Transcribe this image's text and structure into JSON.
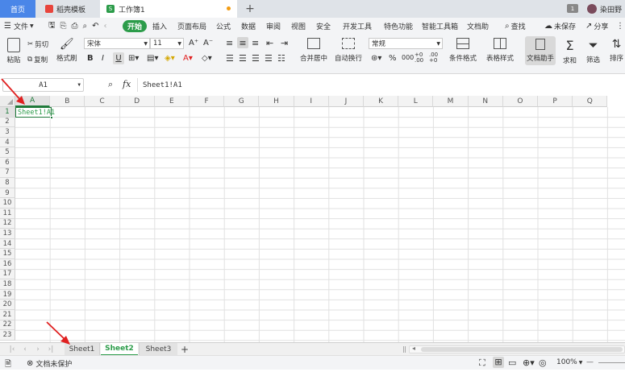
{
  "tabs": {
    "home": "首页",
    "template": "稻壳模板",
    "workbook": "工作簿1"
  },
  "top_right": {
    "badge": "1",
    "user": "染田野"
  },
  "menu": {
    "file": "文件",
    "start": "开始",
    "items": [
      "插入",
      "页面布局",
      "公式",
      "数据",
      "审阅",
      "视图",
      "安全",
      "开发工具",
      "特色功能",
      "智能工具箱",
      "文档助"
    ],
    "search": "查找",
    "unsaved": "未保存",
    "share": "分享"
  },
  "ribbon": {
    "paste": "粘贴",
    "cut": "剪切",
    "copy": "复制",
    "format_painter": "格式刷",
    "font_name": "宋体",
    "font_size": "11",
    "bold": "B",
    "italic": "I",
    "underline": "U",
    "merge": "合并居中",
    "wrap": "自动换行",
    "number_format": "常规",
    "cond_format": "条件格式",
    "table_style": "表格样式",
    "doc_helper": "文档助手",
    "sum": "求和",
    "filter": "筛选",
    "sort": "排序",
    "percent": "%",
    "thousands": "000",
    "inc_dec": "+0 .00",
    "dec_dec": ".00 +0"
  },
  "formula": {
    "cell_ref": "A1",
    "fx": "fx",
    "content": "Sheet1!A1"
  },
  "grid": {
    "columns": [
      "A",
      "B",
      "C",
      "D",
      "E",
      "F",
      "G",
      "H",
      "I",
      "J",
      "K",
      "L",
      "M",
      "N",
      "O",
      "P",
      "Q"
    ],
    "rows": [
      "1",
      "2",
      "3",
      "4",
      "5",
      "6",
      "7",
      "8",
      "9",
      "10",
      "11",
      "12",
      "13",
      "14",
      "15",
      "16",
      "17",
      "18",
      "19",
      "20",
      "21",
      "22",
      "23"
    ],
    "a1_value": "Sheet1!A1"
  },
  "sheets": {
    "tabs": [
      "Sheet1",
      "Sheet2",
      "Sheet3"
    ],
    "active": "Sheet2",
    "add": "+"
  },
  "status": {
    "protect": "文档未保护",
    "zoom": "100%",
    "minus": "—"
  },
  "colors": {
    "accent_green": "#2c9c4a",
    "annotation_red": "#e02020",
    "grid_line": "#e1e1e1",
    "selection": "#1f7a3a"
  }
}
